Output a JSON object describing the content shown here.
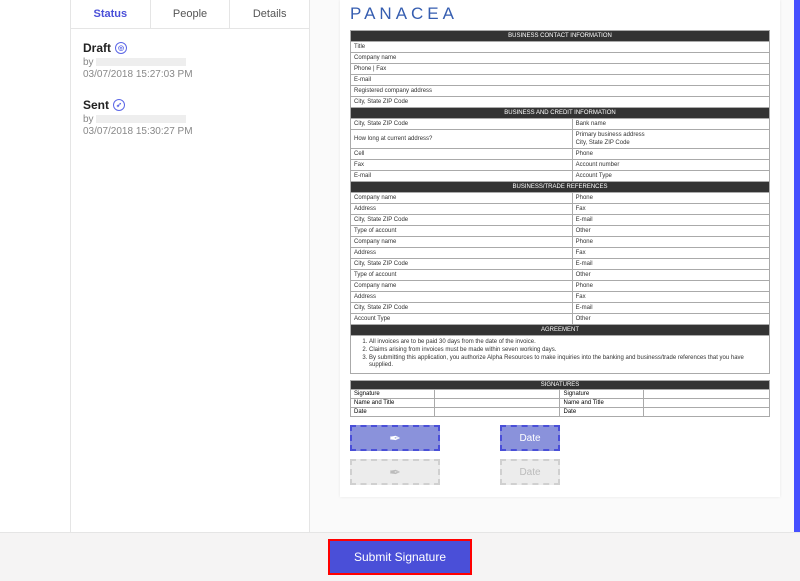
{
  "tabs": {
    "status": "Status",
    "people": "People",
    "details": "Details"
  },
  "history": [
    {
      "title": "Draft",
      "by_prefix": "by",
      "time": "03/07/2018 15:27:03 PM"
    },
    {
      "title": "Sent",
      "by_prefix": "by",
      "time": "03/07/2018 15:30:27 PM"
    }
  ],
  "doc": {
    "brand": "PANACEA",
    "sections": {
      "contact_header": "BUSINESS CONTACT INFORMATION",
      "contact_rows": [
        "Title",
        "Company name",
        "Phone | Fax",
        "E-mail",
        "Registered company address",
        "City, State ZIP Code"
      ],
      "credit_header": "BUSINESS AND CREDIT INFORMATION",
      "credit_rows": [
        [
          "City, State ZIP Code",
          "Bank name"
        ],
        [
          "How long at current address?",
          "Primary business address\nCity, State ZIP Code"
        ],
        [
          "Cell",
          "Phone"
        ],
        [
          "Fax",
          "Account number"
        ],
        [
          "E-mail",
          "Account Type"
        ]
      ],
      "refs_header": "BUSINESS/TRADE REFERENCES",
      "refs_rows": [
        [
          "Company name",
          "Phone"
        ],
        [
          "Address",
          "Fax"
        ],
        [
          "City, State ZIP Code",
          "E-mail"
        ],
        [
          "Type of account",
          "Other"
        ],
        [
          "Company name",
          "Phone"
        ],
        [
          "Address",
          "Fax"
        ],
        [
          "City, State ZIP Code",
          "E-mail"
        ],
        [
          "Type of account",
          "Other"
        ],
        [
          "Company name",
          "Phone"
        ],
        [
          "Address",
          "Fax"
        ],
        [
          "City, State ZIP Code",
          "E-mail"
        ],
        [
          "Account Type",
          "Other"
        ]
      ],
      "agreement_header": "AGREEMENT",
      "agreement_items": [
        "All invoices are to be paid 30 days from the date of the invoice.",
        "Claims arising from invoices must be made within seven working days.",
        "By submitting this application, you authorize Alpha Resources to make inquiries into the banking and business/trade references that you have supplied."
      ],
      "signatures_header": "SIGNATURES",
      "sig_rows": [
        [
          "Signature",
          "Signature"
        ],
        [
          "Name and Title",
          "Name and Title"
        ],
        [
          "Date",
          "Date"
        ]
      ]
    },
    "sig_ui": {
      "date_label": "Date"
    }
  },
  "footer": {
    "submit": "Submit Signature"
  }
}
